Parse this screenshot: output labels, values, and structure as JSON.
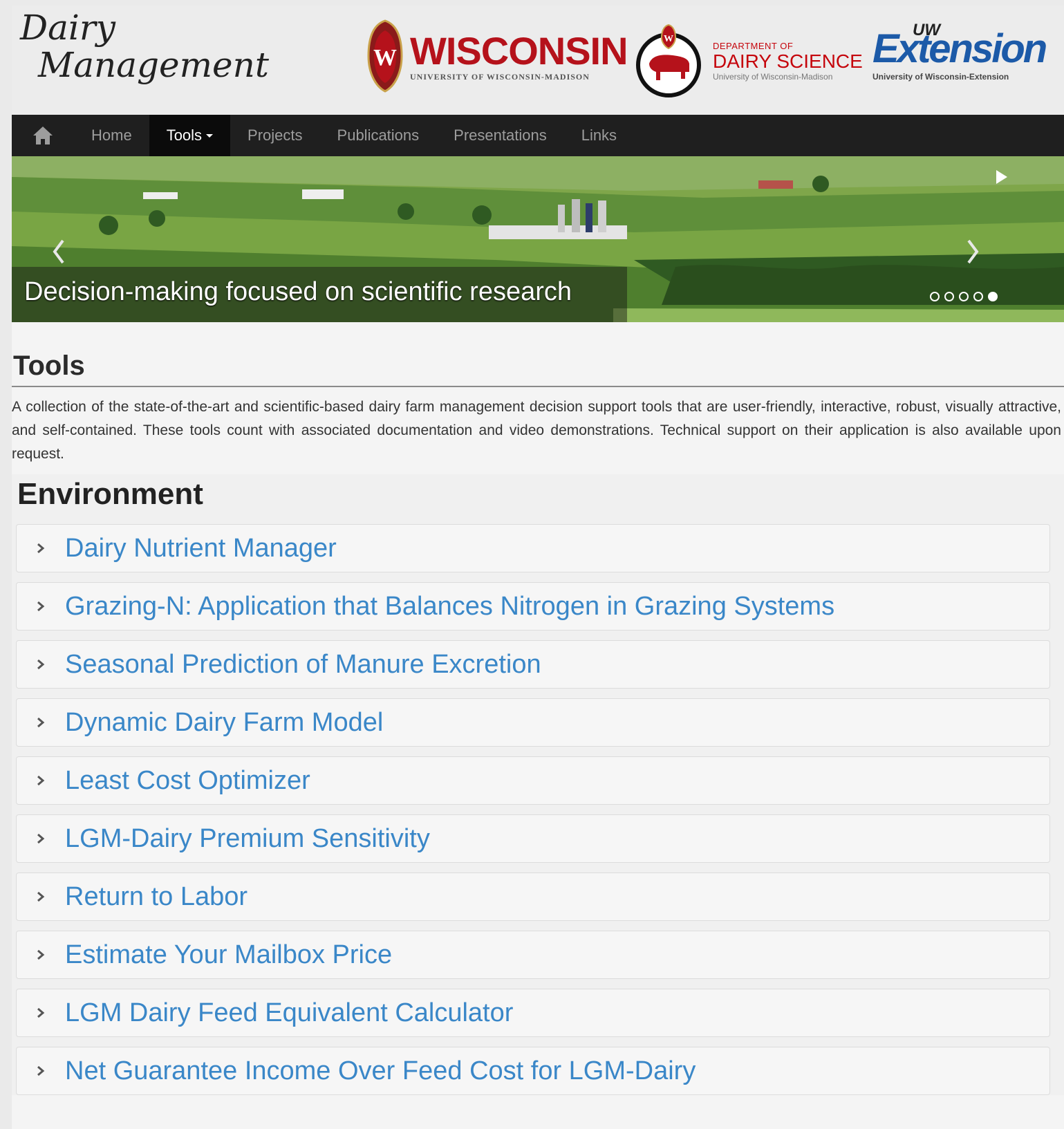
{
  "header": {
    "site_logo_line1": "Dairy",
    "site_logo_line2": "Management",
    "uw_logo": {
      "name": "WISCONSIN",
      "subtitle": "UNIVERSITY OF WISCONSIN-MADISON"
    },
    "dairy_science_logo": {
      "line1": "DEPARTMENT OF",
      "line2": "DAIRY SCIENCE",
      "line3": "University of Wisconsin-Madison"
    },
    "extension_logo": {
      "prefix": "UW",
      "name": "Extension",
      "subtitle": "University of Wisconsin-Extension"
    }
  },
  "nav": {
    "home_icon": "home-icon",
    "items": [
      {
        "label": "Home",
        "active": false
      },
      {
        "label": "Tools",
        "active": true
      },
      {
        "label": "Projects",
        "active": false
      },
      {
        "label": "Publications",
        "active": false
      },
      {
        "label": "Presentations",
        "active": false
      },
      {
        "label": "Links",
        "active": false
      }
    ]
  },
  "hero": {
    "caption": "Decision-making focused on scientific research",
    "slide_count": 5,
    "active_slide": 5
  },
  "tools": {
    "title": "Tools",
    "description": "A collection of the state-of-the-art and scientific-based dairy farm management decision support tools that are user-friendly, interactive, robust, visually attractive, and self-contained. These tools count with associated documentation and video demonstrations. Technical support on their application is also available upon request."
  },
  "environment": {
    "title": "Environment",
    "items": [
      "Dairy Nutrient Manager",
      "Grazing-N: Application that Balances Nitrogen in Grazing Systems",
      "Seasonal Prediction of Manure Excretion",
      "Dynamic Dairy Farm Model",
      "Least Cost Optimizer",
      "LGM-Dairy Premium Sensitivity",
      "Return to Labor",
      "Estimate Your Mailbox Price",
      "LGM Dairy Feed Equivalent Calculator",
      "Net Guarantee Income Over Feed Cost for LGM-Dairy"
    ]
  },
  "colors": {
    "link_blue": "#3a87c8",
    "navbar_bg": "#1f1f1f",
    "uw_red": "#b5121b",
    "extension_blue": "#1c5aa8"
  }
}
